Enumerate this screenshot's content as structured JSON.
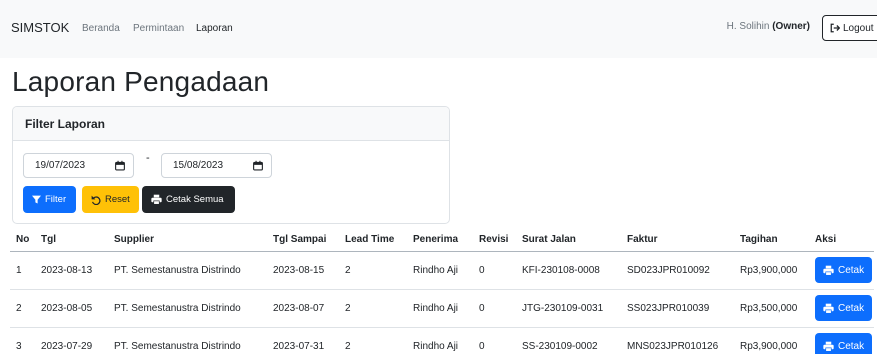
{
  "nav": {
    "brand": "SIMSTOK",
    "links": [
      {
        "label": "Beranda"
      },
      {
        "label": "Permintaan"
      },
      {
        "label": "Laporan"
      }
    ],
    "user_name": "H. Solihin",
    "user_role": "(Owner)",
    "logout_label": "Logout"
  },
  "page": {
    "title": "Laporan Pengadaan"
  },
  "filter": {
    "title": "Filter Laporan",
    "date_from": "19/07/2023",
    "separator": "-",
    "date_to": "15/08/2023",
    "filter_label": "Filter",
    "reset_label": "Reset",
    "print_all_label": "Cetak Semua"
  },
  "table": {
    "headers": [
      "No",
      "Tgl",
      "Supplier",
      "Tgl Sampai",
      "Lead Time",
      "Penerima",
      "Revisi",
      "Surat Jalan",
      "Faktur",
      "Tagihan",
      "Aksi"
    ],
    "action_label": "Cetak",
    "rows": [
      [
        "1",
        "2023-08-13",
        "PT. Semestanustra Distrindo",
        "2023-08-15",
        "2",
        "Rindho Aji",
        "0",
        "KFI-230108-0008",
        "SD023JPR010092",
        "Rp3,900,000"
      ],
      [
        "2",
        "2023-08-05",
        "PT. Semestanustra Distrindo",
        "2023-08-07",
        "2",
        "Rindho Aji",
        "0",
        "JTG-230109-0031",
        "SS023JPR010039",
        "Rp3,500,000"
      ],
      [
        "3",
        "2023-07-29",
        "PT. Semestanustra Distrindo",
        "2023-07-31",
        "2",
        "Rindho Aji",
        "0",
        "SS-230109-0002",
        "MNS023JPR010126",
        "Rp3,900,000"
      ]
    ]
  },
  "icons": {
    "logout": "logout-arrow-icon",
    "calendar": "calendar-icon",
    "filter": "funnel-icon",
    "reset": "undo-icon",
    "print": "printer-icon"
  },
  "colors": {
    "primary": "#0d6efd",
    "warning": "#ffc107",
    "dark": "#212529",
    "navbar_bg": "#f8f9fa"
  }
}
